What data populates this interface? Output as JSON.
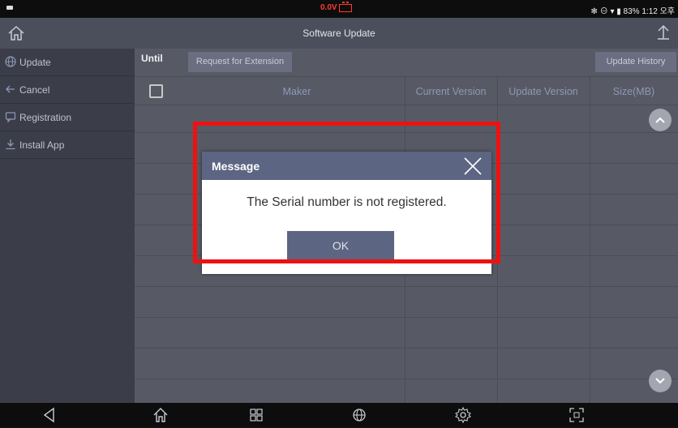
{
  "status_bar": {
    "voltage": "0.0V",
    "right_text": "✻ ⊖ ▾ ▮ 83% 1:12 오후",
    "alert_color": "#ff3b2f"
  },
  "title_bar": {
    "title": "Software Update",
    "home_icon": "home-icon",
    "upload_icon": "upload-icon"
  },
  "sidebar": {
    "items": [
      {
        "label": "Update",
        "icon": "globe-icon"
      },
      {
        "label": "Cancel",
        "icon": "arrow-left-icon"
      },
      {
        "label": "Registration",
        "icon": "registration-icon"
      },
      {
        "label": "Install App",
        "icon": "download-icon"
      }
    ]
  },
  "toolbar": {
    "until_label": "Until",
    "extension_button": "Request for Extension",
    "history_button": "Update History"
  },
  "table": {
    "columns": [
      "Maker",
      "Current Version",
      "Update Version",
      "Size(MB)"
    ],
    "rows": []
  },
  "dialog": {
    "title": "Message",
    "message": "The Serial number is not registered.",
    "ok_label": "OK",
    "accent": "#5c6582"
  },
  "highlight": {
    "color": "#ee1111"
  },
  "nav_bar": {
    "icons": [
      "back-icon",
      "home-icon",
      "recent-apps-icon",
      "globe-icon",
      "settings-icon",
      "screenshot-icon"
    ]
  }
}
